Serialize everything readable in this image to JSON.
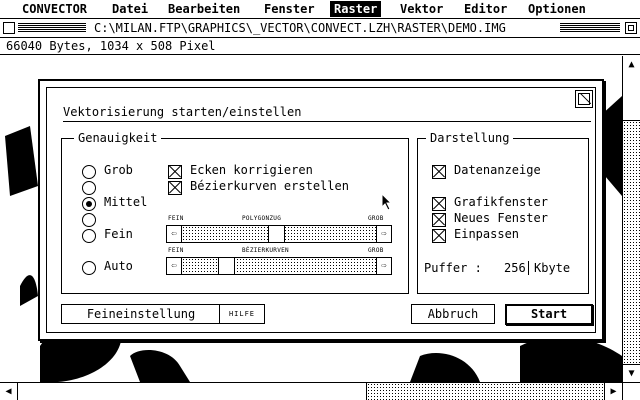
{
  "menubar": {
    "items": [
      {
        "label": "CONVECTOR",
        "active": false
      },
      {
        "label": "Datei",
        "active": false
      },
      {
        "label": "Bearbeiten",
        "active": false
      },
      {
        "label": "Fenster",
        "active": false
      },
      {
        "label": "Raster",
        "active": true
      },
      {
        "label": "Vektor",
        "active": false
      },
      {
        "label": "Editor",
        "active": false
      },
      {
        "label": "Optionen",
        "active": false
      }
    ]
  },
  "window": {
    "title": "C:\\MILAN.FTP\\GRAPHICS\\_VECTOR\\CONVECT.LZH\\RASTER\\DEMO.IMG",
    "info": "66040 Bytes, 1034 x 508 Pixel"
  },
  "dialog": {
    "title": "Vektorisierung starten/einstellen",
    "genauigkeit": {
      "label": "Genauigkeit",
      "options": [
        "Grob",
        "",
        "Mittel",
        "",
        "Fein",
        "Auto"
      ],
      "selected": "Mittel"
    },
    "checks": {
      "ecken": {
        "label": "Ecken korrigieren",
        "checked": true
      },
      "bezier": {
        "label": "Bézierkurven erstellen",
        "checked": true
      }
    },
    "sliders": [
      {
        "caption_left": "FEIN",
        "caption_mid": "POLYGONZUG",
        "caption_right": "GROB",
        "value_fraction": 0.48
      },
      {
        "caption_left": "FEIN",
        "caption_mid": "BÉZIERKURVEN",
        "caption_right": "GROB",
        "value_fraction": 0.2
      }
    ],
    "darstellung": {
      "label": "Darstellung",
      "datenanzeige": {
        "label": "Datenanzeige",
        "checked": true
      },
      "grafikfenster": {
        "label": "Grafikfenster",
        "checked": true
      },
      "neues_fenster": {
        "label": "Neues Fenster",
        "checked": true
      },
      "einpassen": {
        "label": "Einpassen",
        "checked": true
      },
      "puffer_label": "Puffer :",
      "puffer_value": "256",
      "puffer_unit": "Kbyte"
    },
    "buttons": {
      "feineinstellung": "Feineinstellung",
      "hilfe": "HILFE",
      "abbruch": "Abbruch",
      "start": "Start"
    }
  },
  "icons": {
    "scroll_up": "arrow-up-icon",
    "scroll_down": "arrow-down-icon",
    "scroll_left": "arrow-left-icon",
    "scroll_right": "arrow-right-icon"
  }
}
